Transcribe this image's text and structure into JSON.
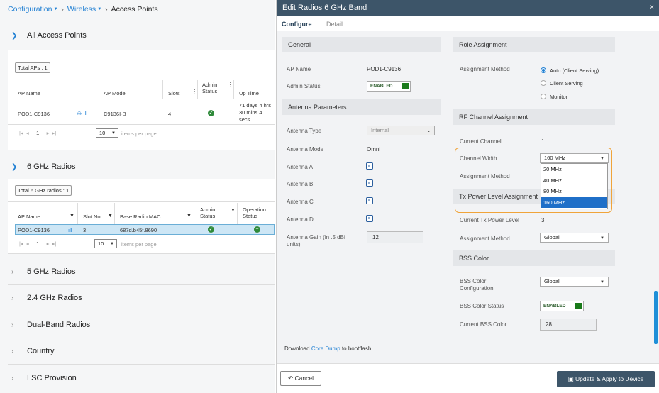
{
  "breadcrumb": {
    "item1": "Configuration",
    "item2": "Wireless",
    "current": "Access Points"
  },
  "all_aps": {
    "title": "All Access Points",
    "total": "Total APs : 1",
    "columns": {
      "ap_name": "AP Name",
      "ap_model": "AP Model",
      "slots": "Slots",
      "admin_status_1": "Admin",
      "admin_status_2": "Status",
      "up_time": "Up Time"
    },
    "row": {
      "ap_name": "POD1-C9136",
      "ap_model": "C9136I-B",
      "slots": "4",
      "up_time_1": "71 days 4 hrs",
      "up_time_2": "30 mins 4",
      "up_time_3": "secs"
    },
    "page": "1",
    "per_page": "10",
    "per_page_label": "items per page"
  },
  "radios_6ghz": {
    "title": "6 GHz Radios",
    "total": "Total 6 GHz radios : 1",
    "columns": {
      "ap_name": "AP Name",
      "slot_no": "Slot No",
      "base_radio_mac": "Base Radio MAC",
      "admin_status_1": "Admin",
      "admin_status_2": "Status",
      "operation_status_1": "Operation",
      "operation_status_2": "Status"
    },
    "row": {
      "ap_name": "POD1-C9136",
      "slot_no": "3",
      "base_radio_mac": "687d.b45f.8690"
    },
    "page": "1",
    "per_page": "10",
    "per_page_label": "items per page"
  },
  "collapsed_sections": {
    "s1": "5 GHz Radios",
    "s2": "2.4 GHz Radios",
    "s3": "Dual-Band Radios",
    "s4": "Country",
    "s5": "LSC Provision"
  },
  "modal": {
    "title": "Edit Radios 6 GHz Band",
    "close": "×",
    "tabs": {
      "configure": "Configure",
      "detail": "Detail"
    },
    "general": {
      "header": "General",
      "ap_name_label": "AP Name",
      "ap_name": "POD1-C9136",
      "admin_status_label": "Admin Status",
      "admin_status": "ENABLED"
    },
    "antenna": {
      "header": "Antenna Parameters",
      "type_label": "Antenna Type",
      "type": "Internal",
      "mode_label": "Antenna Mode",
      "mode": "Omni",
      "a": "Antenna A",
      "b": "Antenna B",
      "c": "Antenna C",
      "d": "Antenna D",
      "gain_label_1": "Antenna Gain (in .5 dBi",
      "gain_label_2": "units)",
      "gain": "12"
    },
    "download": {
      "prefix": "Download ",
      "link": "Core Dump",
      "suffix": " to bootflash"
    },
    "role": {
      "header": "Role Assignment",
      "method_label": "Assignment Method",
      "opt1": "Auto (Client Serving)",
      "opt2": "Client Serving",
      "opt3": "Monitor"
    },
    "rf": {
      "header": "RF Channel Assignment",
      "current_label": "Current Channel",
      "current": "1",
      "width_label": "Channel Width",
      "width": "160 MHz",
      "method_label": "Assignment Method",
      "options": [
        "20 MHz",
        "40 MHz",
        "80 MHz",
        "160 MHz"
      ],
      "selected_index": 3
    },
    "tx": {
      "header": "Tx Power Level Assignment",
      "current_label": "Current Tx Power Level",
      "current": "3",
      "method_label": "Assignment Method",
      "method": "Global"
    },
    "bss": {
      "header": "BSS Color",
      "config_label_1": "BSS Color",
      "config_label_2": "Configuration",
      "config": "Global",
      "status_label": "BSS Color Status",
      "status": "ENABLED",
      "current_label": "Current BSS Color",
      "current": "28"
    },
    "footer": {
      "cancel": "Cancel",
      "apply": "Update & Apply to Device"
    }
  }
}
